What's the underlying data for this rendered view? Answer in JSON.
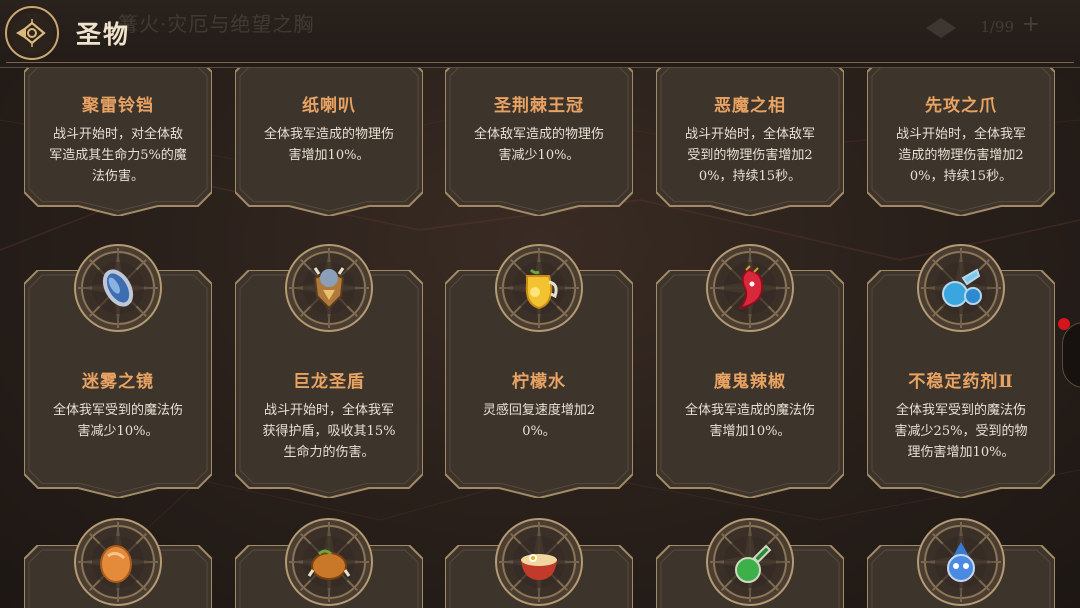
{
  "header": {
    "title": "圣物",
    "ghost_subtitle": "篝火·灾厄与绝望之胸",
    "ghost_count": "1/99",
    "ghost_plus": "+",
    "back_icon": "back-emblem-icon"
  },
  "colors": {
    "name_orange": "#e8a363",
    "desc_text": "#e9e1d3",
    "card_fill": "#3d342c",
    "card_border": "#a38a66",
    "gold": "#c9a770",
    "notification_dot": "#d6141c"
  },
  "relics": [
    {
      "name": "聚雷铃铛",
      "desc": "战斗开始时，对全体敌军造成其生命力5%的魔法伤害。",
      "icon": "bell-icon"
    },
    {
      "name": "纸喇叭",
      "desc": "全体我军造成的物理伤害增加10%。",
      "icon": "paper-horn-icon"
    },
    {
      "name": "圣荆棘王冠",
      "desc": "全体敌军造成的物理伤害减少10%。",
      "icon": "thorn-crown-icon"
    },
    {
      "name": "恶魔之相",
      "desc": "战斗开始时，全体敌军受到的物理伤害增加20%，持续15秒。",
      "icon": "demon-face-icon"
    },
    {
      "name": "先攻之爪",
      "desc": "战斗开始时，全体我军造成的物理伤害增加20%，持续15秒。",
      "icon": "claw-icon"
    },
    {
      "name": "迷雾之镜",
      "desc": "全体我军受到的魔法伤害减少10%。",
      "icon": "mirror-icon"
    },
    {
      "name": "巨龙圣盾",
      "desc": "战斗开始时，全体我军获得护盾，吸收其15%生命力的伤害。",
      "icon": "dragon-shield-icon"
    },
    {
      "name": "柠檬水",
      "desc": "灵感回复速度增加20%。",
      "icon": "lemonade-jug-icon"
    },
    {
      "name": "魔鬼辣椒",
      "desc": "全体我军造成的魔法伤害增加10%。",
      "icon": "devil-pepper-icon"
    },
    {
      "name": "不稳定药剂Ⅱ",
      "desc": "全体我军受到的魔法伤害减少25%，受到的物理伤害增加10%。",
      "icon": "unstable-potion-icon"
    },
    {
      "name": "",
      "desc": "",
      "icon": "orange-gem-icon"
    },
    {
      "name": "",
      "desc": "",
      "icon": "roast-chicken-icon"
    },
    {
      "name": "",
      "desc": "",
      "icon": "ramen-bowl-icon"
    },
    {
      "name": "",
      "desc": "",
      "icon": "green-flask-icon"
    },
    {
      "name": "",
      "desc": "",
      "icon": "blue-creature-icon"
    }
  ]
}
